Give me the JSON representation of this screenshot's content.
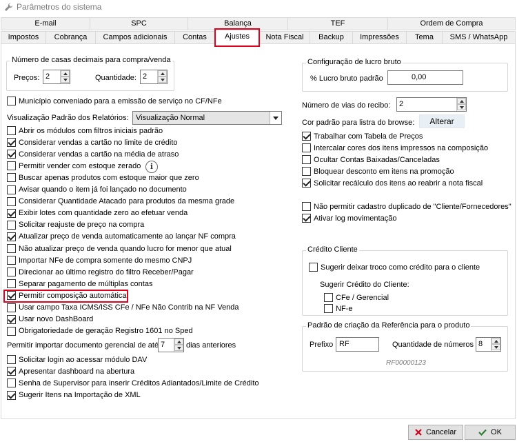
{
  "window": {
    "title": "Parâmetros do sistema"
  },
  "tabs": {
    "row1": [
      "E-mail",
      "SPC",
      "Balança",
      "TEF",
      "Ordem de Compra"
    ],
    "row2": [
      "Impostos",
      "Cobrança",
      "Campos adicionais",
      "Contas",
      "Ajustes",
      "Nota Fiscal",
      "Backup",
      "Impressões",
      "Tema",
      "SMS / WhatsApp"
    ]
  },
  "left": {
    "decimals": {
      "title": "Número de casas decimais para compra/venda",
      "precos_label": "Preços:",
      "precos_value": "2",
      "quantidade_label": "Quantidade:",
      "quantidade_value": "2"
    },
    "municipio": {
      "label": "Município conveniado para a emissão de serviço no CF/NFe",
      "checked": false
    },
    "report_view": {
      "label": "Visualização Padrão dos Relatórios:",
      "value": "Visualização Normal"
    },
    "checks1": [
      {
        "label": "Abrir os módulos com filtros iniciais padrão",
        "checked": false
      },
      {
        "label": "Considerar vendas a cartão no limite de crédito",
        "checked": true
      },
      {
        "label": "Considerar vendas a cartão na média de atraso",
        "checked": true
      },
      {
        "label": "Permitir vender com estoque zerado",
        "checked": false
      },
      {
        "label": "Buscar apenas produtos com estoque maior que zero",
        "checked": false
      },
      {
        "label": "Avisar quando o item já foi lançado no documento",
        "checked": false
      },
      {
        "label": "Considerar Quantidade Atacado para produtos da mesma grade",
        "checked": false
      },
      {
        "label": "Exibir lotes com quantidade zero ao efetuar venda",
        "checked": true
      },
      {
        "label": "Solicitar reajuste de preço na compra",
        "checked": false
      },
      {
        "label": "Atualizar preço de venda automaticamente ao lançar NF compra",
        "checked": true
      },
      {
        "label": "Não atualizar preço de venda quando lucro for menor que atual",
        "checked": false
      },
      {
        "label": "Importar NFe de compra somente do mesmo CNPJ",
        "checked": false
      },
      {
        "label": "Direcionar ao último registro do filtro Receber/Pagar",
        "checked": false
      },
      {
        "label": "Separar pagamento de múltiplas contas",
        "checked": false
      },
      {
        "label": "Permitir composição automática",
        "checked": true
      },
      {
        "label": "Usar campo Taxa ICMS/ISS CFe / NFe Não Contrib na NF Venda",
        "checked": false
      },
      {
        "label": "Usar novo DashBoard",
        "checked": true
      },
      {
        "label": "Obrigatoriedade de geração Registro 1601 no Sped",
        "checked": false
      }
    ],
    "gerencial": {
      "label": "Permitir importar documento gerencial de até",
      "value": "7",
      "suffix": "dias anteriores"
    },
    "checks2": [
      {
        "label": "Solicitar login ao acessar módulo DAV",
        "checked": false
      },
      {
        "label": "Apresentar dashboard na abertura",
        "checked": true
      },
      {
        "label": "Senha de Supervisor para inserir Créditos Adiantados/Limite de Crédito",
        "checked": false
      },
      {
        "label": "Sugerir Itens na Importação de XML",
        "checked": true
      }
    ]
  },
  "right": {
    "lucro": {
      "title": "Configuração de lucro bruto",
      "label": "% Lucro bruto padrão",
      "value": "0,00"
    },
    "vias": {
      "label": "Número de vias do recibo:",
      "value": "2"
    },
    "cor": {
      "label": "Cor padrão para listra do browse:",
      "button": "Alterar"
    },
    "checks1": [
      {
        "label": "Trabalhar com Tabela de Preços",
        "checked": true
      },
      {
        "label": "Intercalar cores dos itens impressos na composição",
        "checked": false
      },
      {
        "label": "Ocultar Contas Baixadas/Canceladas",
        "checked": false
      },
      {
        "label": "Bloquear desconto em itens na promoção",
        "checked": false
      },
      {
        "label": "Solicitar recálculo dos itens ao reabrir a nota fiscal",
        "checked": true
      }
    ],
    "checks2": [
      {
        "label": "Não permitir cadastro duplicado de \"Cliente/Fornecedores\"",
        "checked": false
      },
      {
        "label": "Ativar log movimentação",
        "checked": true
      }
    ],
    "credito": {
      "title": "Crédito Cliente",
      "troco": {
        "label": "Sugerir deixar troco como crédito para o cliente",
        "checked": false
      },
      "sub_label": "Sugerir Crédito do Cliente:",
      "cfe": {
        "label": "CFe / Gerencial",
        "checked": false
      },
      "nfe": {
        "label": "NF-e",
        "checked": false
      }
    },
    "referencia": {
      "title": "Padrão de criação da Referência para o produto",
      "prefixo_label": "Prefixo",
      "prefixo_value": "RF",
      "qtd_label": "Quantidade de números",
      "qtd_value": "8",
      "example": "RF00000123"
    }
  },
  "footer": {
    "cancel": "Cancelar",
    "ok": "OK"
  },
  "colors": {
    "highlight": "#e0001b",
    "cancel_x": "#d0021b",
    "ok_check": "#2e7d32"
  }
}
